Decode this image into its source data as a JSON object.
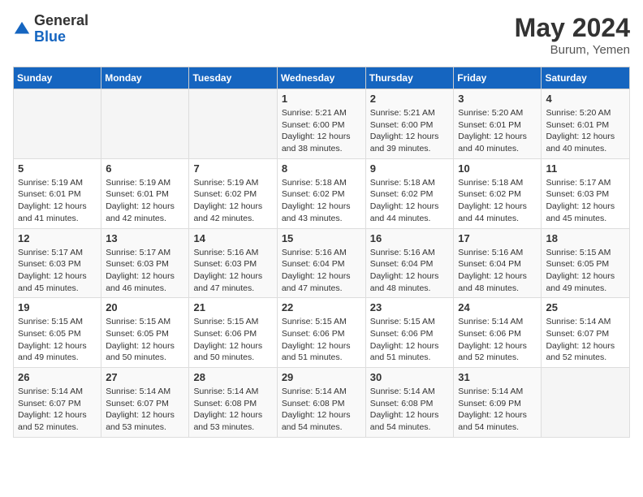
{
  "logo": {
    "general": "General",
    "blue": "Blue"
  },
  "title": {
    "month_year": "May 2024",
    "location": "Burum, Yemen"
  },
  "weekdays": [
    "Sunday",
    "Monday",
    "Tuesday",
    "Wednesday",
    "Thursday",
    "Friday",
    "Saturday"
  ],
  "weeks": [
    [
      {
        "day": "",
        "info": ""
      },
      {
        "day": "",
        "info": ""
      },
      {
        "day": "",
        "info": ""
      },
      {
        "day": "1",
        "info": "Sunrise: 5:21 AM\nSunset: 6:00 PM\nDaylight: 12 hours\nand 38 minutes."
      },
      {
        "day": "2",
        "info": "Sunrise: 5:21 AM\nSunset: 6:00 PM\nDaylight: 12 hours\nand 39 minutes."
      },
      {
        "day": "3",
        "info": "Sunrise: 5:20 AM\nSunset: 6:01 PM\nDaylight: 12 hours\nand 40 minutes."
      },
      {
        "day": "4",
        "info": "Sunrise: 5:20 AM\nSunset: 6:01 PM\nDaylight: 12 hours\nand 40 minutes."
      }
    ],
    [
      {
        "day": "5",
        "info": "Sunrise: 5:19 AM\nSunset: 6:01 PM\nDaylight: 12 hours\nand 41 minutes."
      },
      {
        "day": "6",
        "info": "Sunrise: 5:19 AM\nSunset: 6:01 PM\nDaylight: 12 hours\nand 42 minutes."
      },
      {
        "day": "7",
        "info": "Sunrise: 5:19 AM\nSunset: 6:02 PM\nDaylight: 12 hours\nand 42 minutes."
      },
      {
        "day": "8",
        "info": "Sunrise: 5:18 AM\nSunset: 6:02 PM\nDaylight: 12 hours\nand 43 minutes."
      },
      {
        "day": "9",
        "info": "Sunrise: 5:18 AM\nSunset: 6:02 PM\nDaylight: 12 hours\nand 44 minutes."
      },
      {
        "day": "10",
        "info": "Sunrise: 5:18 AM\nSunset: 6:02 PM\nDaylight: 12 hours\nand 44 minutes."
      },
      {
        "day": "11",
        "info": "Sunrise: 5:17 AM\nSunset: 6:03 PM\nDaylight: 12 hours\nand 45 minutes."
      }
    ],
    [
      {
        "day": "12",
        "info": "Sunrise: 5:17 AM\nSunset: 6:03 PM\nDaylight: 12 hours\nand 45 minutes."
      },
      {
        "day": "13",
        "info": "Sunrise: 5:17 AM\nSunset: 6:03 PM\nDaylight: 12 hours\nand 46 minutes."
      },
      {
        "day": "14",
        "info": "Sunrise: 5:16 AM\nSunset: 6:03 PM\nDaylight: 12 hours\nand 47 minutes."
      },
      {
        "day": "15",
        "info": "Sunrise: 5:16 AM\nSunset: 6:04 PM\nDaylight: 12 hours\nand 47 minutes."
      },
      {
        "day": "16",
        "info": "Sunrise: 5:16 AM\nSunset: 6:04 PM\nDaylight: 12 hours\nand 48 minutes."
      },
      {
        "day": "17",
        "info": "Sunrise: 5:16 AM\nSunset: 6:04 PM\nDaylight: 12 hours\nand 48 minutes."
      },
      {
        "day": "18",
        "info": "Sunrise: 5:15 AM\nSunset: 6:05 PM\nDaylight: 12 hours\nand 49 minutes."
      }
    ],
    [
      {
        "day": "19",
        "info": "Sunrise: 5:15 AM\nSunset: 6:05 PM\nDaylight: 12 hours\nand 49 minutes."
      },
      {
        "day": "20",
        "info": "Sunrise: 5:15 AM\nSunset: 6:05 PM\nDaylight: 12 hours\nand 50 minutes."
      },
      {
        "day": "21",
        "info": "Sunrise: 5:15 AM\nSunset: 6:06 PM\nDaylight: 12 hours\nand 50 minutes."
      },
      {
        "day": "22",
        "info": "Sunrise: 5:15 AM\nSunset: 6:06 PM\nDaylight: 12 hours\nand 51 minutes."
      },
      {
        "day": "23",
        "info": "Sunrise: 5:15 AM\nSunset: 6:06 PM\nDaylight: 12 hours\nand 51 minutes."
      },
      {
        "day": "24",
        "info": "Sunrise: 5:14 AM\nSunset: 6:06 PM\nDaylight: 12 hours\nand 52 minutes."
      },
      {
        "day": "25",
        "info": "Sunrise: 5:14 AM\nSunset: 6:07 PM\nDaylight: 12 hours\nand 52 minutes."
      }
    ],
    [
      {
        "day": "26",
        "info": "Sunrise: 5:14 AM\nSunset: 6:07 PM\nDaylight: 12 hours\nand 52 minutes."
      },
      {
        "day": "27",
        "info": "Sunrise: 5:14 AM\nSunset: 6:07 PM\nDaylight: 12 hours\nand 53 minutes."
      },
      {
        "day": "28",
        "info": "Sunrise: 5:14 AM\nSunset: 6:08 PM\nDaylight: 12 hours\nand 53 minutes."
      },
      {
        "day": "29",
        "info": "Sunrise: 5:14 AM\nSunset: 6:08 PM\nDaylight: 12 hours\nand 54 minutes."
      },
      {
        "day": "30",
        "info": "Sunrise: 5:14 AM\nSunset: 6:08 PM\nDaylight: 12 hours\nand 54 minutes."
      },
      {
        "day": "31",
        "info": "Sunrise: 5:14 AM\nSunset: 6:09 PM\nDaylight: 12 hours\nand 54 minutes."
      },
      {
        "day": "",
        "info": ""
      }
    ]
  ]
}
